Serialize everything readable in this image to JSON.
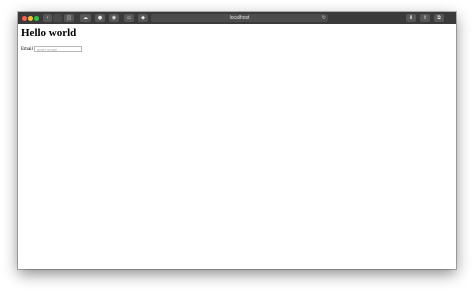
{
  "browser": {
    "address": "localhost",
    "colors": {
      "toolbar": "#3a3a3a",
      "close": "#fe5f57",
      "minimize": "#febc2e",
      "maximize": "#28c840"
    }
  },
  "page": {
    "heading": "Hello world",
    "email_label": "Email",
    "email_placeholder": "enter email",
    "email_value": ""
  },
  "icons": {
    "back": "chevron-left-icon",
    "forward": "chevron-right-icon",
    "sidebar": "sidebar-icon",
    "cloud": "cloud-icon",
    "reload": "reload-icon",
    "download": "download-icon",
    "share": "share-icon",
    "tabs": "tabs-icon"
  }
}
